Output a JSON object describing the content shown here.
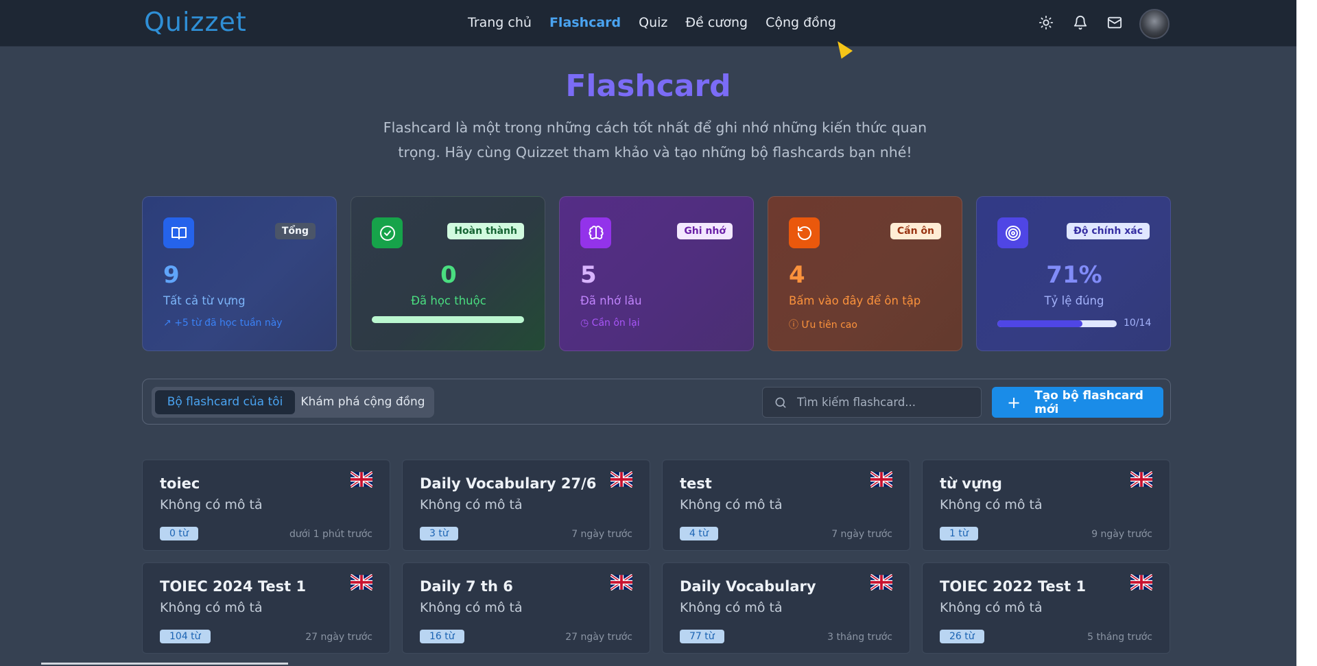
{
  "nav": {
    "logo": "Quizzet",
    "links": [
      "Trang chủ",
      "Flashcard",
      "Quiz",
      "Đề cương",
      "Cộng đồng"
    ],
    "active": "Flashcard"
  },
  "header": {
    "title": "Flashcard",
    "description": "Flashcard là một trong những cách tốt nhất để ghi nhớ những kiến thức quan trọng. Hãy cùng Quizzet tham khảo và tạo những bộ flashcards bạn nhé!"
  },
  "stats": [
    {
      "badge": "Tổng",
      "value": "9",
      "label": "Tất cả từ vựng",
      "sub": "+5 từ đã học tuần này",
      "color": "#3b82f6"
    },
    {
      "badge": "Hoàn thành",
      "value": "0",
      "label": "Đã học thuộc",
      "progress": 1.0,
      "color": "#22c55e"
    },
    {
      "badge": "Ghi nhớ",
      "value": "5",
      "label": "Đã nhớ lâu",
      "sub": "Cần ôn lại",
      "color": "#a855f7"
    },
    {
      "badge": "Cần ôn",
      "value": "4",
      "label": "Bấm vào đây để ôn tập",
      "sub": "Ưu tiên cao",
      "color": "#f97316"
    },
    {
      "badge": "Độ chính xác",
      "value": "71%",
      "label": "Tỷ lệ đúng",
      "progress": 0.71,
      "progress_text": "10/14",
      "color": "#6366f1"
    }
  ],
  "toolbar": {
    "tabs": [
      "Bộ flashcard của tôi",
      "Khám phá cộng đồng"
    ],
    "active_tab": "Bộ flashcard của tôi",
    "search_placeholder": "Tìm kiếm flashcard...",
    "create_label": "Tạo bộ flashcard mới"
  },
  "sets": [
    {
      "title": "toiec",
      "desc": "Không có mô tả",
      "count": "0 từ",
      "time": "dưới 1 phút trước"
    },
    {
      "title": "Daily Vocabulary 27/6",
      "desc": "Không có mô tả",
      "count": "3 từ",
      "time": "7 ngày trước"
    },
    {
      "title": "test",
      "desc": "Không có mô tả",
      "count": "4 từ",
      "time": "7 ngày trước"
    },
    {
      "title": "từ vựng",
      "desc": "Không có mô tả",
      "count": "1 từ",
      "time": "9 ngày trước"
    },
    {
      "title": "TOIEC 2024 Test 1",
      "desc": "Không có mô tả",
      "count": "104 từ",
      "time": "27 ngày trước"
    },
    {
      "title": "Daily 7 th 6",
      "desc": "Không có mô tả",
      "count": "16 từ",
      "time": "27 ngày trước"
    },
    {
      "title": "Daily Vocabulary",
      "desc": "Không có mô tả",
      "count": "77 từ",
      "time": "3 tháng trước"
    },
    {
      "title": "TOIEC 2022 Test 1",
      "desc": "Không có mô tả",
      "count": "26 từ",
      "time": "5 tháng trước"
    }
  ]
}
